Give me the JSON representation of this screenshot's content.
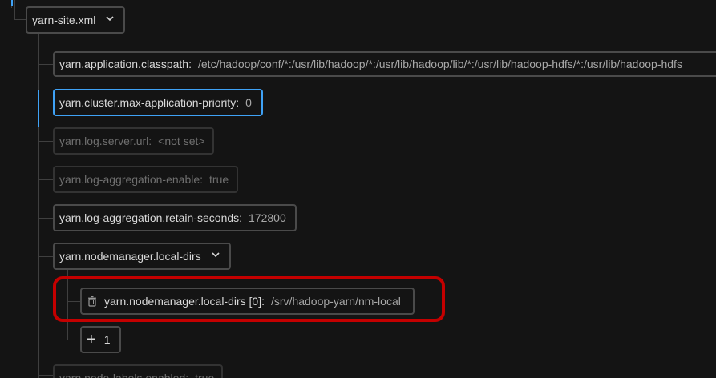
{
  "tree": {
    "root": {
      "label": "yarn-site.xml"
    },
    "properties": [
      {
        "key": "yarn.application.classpath:",
        "value": "/etc/hadoop/conf/*:/usr/lib/hadoop/*:/usr/lib/hadoop/lib/*:/usr/lib/hadoop-hdfs/*:/usr/lib/hadoop-hdfs"
      },
      {
        "key": "yarn.cluster.max-application-priority:",
        "value": "0"
      },
      {
        "key": "yarn.log.server.url:",
        "value": "<not set>"
      },
      {
        "key": "yarn.log-aggregation-enable:",
        "value": "true"
      },
      {
        "key": "yarn.log-aggregation.retain-seconds:",
        "value": "172800"
      },
      {
        "key": "yarn.nodemanager.local-dirs"
      },
      {
        "key": "yarn.node-labels.enabled:",
        "value": "true"
      }
    ],
    "local_dirs_children": [
      {
        "key": "yarn.nodemanager.local-dirs [0]:",
        "value": "/srv/hadoop-yarn/nm-local"
      }
    ],
    "add_button": {
      "icon": "+",
      "count": "1"
    }
  },
  "colors": {
    "background": "#141414",
    "selected_border": "#3fa2f6",
    "highlight": "#c40000"
  },
  "icons": {
    "expand": "chevron-down-icon",
    "delete": "trash-icon",
    "add": "plus-icon"
  }
}
